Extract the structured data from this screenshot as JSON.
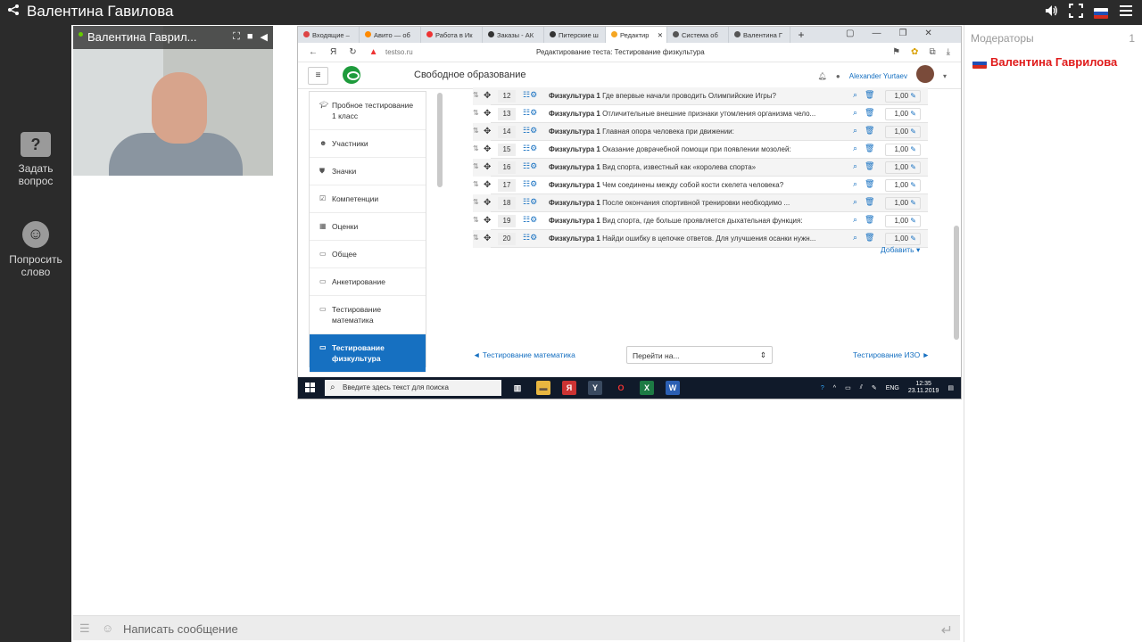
{
  "app": {
    "title": "Валентина Гавилова"
  },
  "left_actions": [
    {
      "icon": "question-icon",
      "label": "Задать вопрос"
    },
    {
      "icon": "hand-raise-icon",
      "label": "Попросить слово"
    }
  ],
  "video": {
    "name": "Валентина Гаврил..."
  },
  "browser": {
    "tabs": [
      {
        "label": "Входящие –",
        "color": "#d44"
      },
      {
        "label": "Авито — об",
        "color": "#ff8a00"
      },
      {
        "label": "Работа в Ик",
        "color": "#e33"
      },
      {
        "label": "Заказы - АК",
        "color": "#333"
      },
      {
        "label": "Питерские ш",
        "color": "#333"
      },
      {
        "label": "Редактир",
        "color": "#f5a623",
        "active": true
      },
      {
        "label": "Система об",
        "color": "#555"
      },
      {
        "label": "Валентина Г",
        "color": "#555"
      }
    ],
    "url": "testso.ru",
    "page_title": "Редактирование теста: Тестирование физкультура",
    "site_name": "Свободное образование",
    "user_name": "Alexander Yurtaev"
  },
  "sidebar": {
    "items": [
      {
        "icon": "graduation-icon",
        "label": "Пробное тестирование 1 класс"
      },
      {
        "icon": "users-icon",
        "label": "Участники"
      },
      {
        "icon": "shield-icon",
        "label": "Значки"
      },
      {
        "icon": "checkbox-icon",
        "label": "Компетенции"
      },
      {
        "icon": "table-icon",
        "label": "Оценки"
      },
      {
        "icon": "folder-icon",
        "label": "Общее"
      },
      {
        "icon": "folder-icon",
        "label": "Анкетирование"
      },
      {
        "icon": "folder-icon",
        "label": "Тестирование математика"
      },
      {
        "icon": "folder-icon",
        "label": "Тестирование физкультура",
        "active": true
      },
      {
        "icon": "folder-icon",
        "label": "Тестирование ИЗО"
      }
    ]
  },
  "questions": [
    {
      "num": "12",
      "cat": "Физкультура 1",
      "text": "Где впервые начали проводить Олимпийские Игры?",
      "mark": "1,00"
    },
    {
      "num": "13",
      "cat": "Физкультура 1",
      "text": "Отличительные внешние признаки утомления организма чело...",
      "mark": "1,00"
    },
    {
      "num": "14",
      "cat": "Физкультура 1",
      "text": "Главная опора человека при движении:",
      "mark": "1,00"
    },
    {
      "num": "15",
      "cat": "Физкультура 1",
      "text": "Оказание доврачебной помощи при появлении мозолей:",
      "mark": "1,00"
    },
    {
      "num": "16",
      "cat": "Физкультура 1",
      "text": "Вид спорта, известный как «королева спорта»",
      "mark": "1,00"
    },
    {
      "num": "17",
      "cat": "Физкультура 1",
      "text": "Чем соединены между собой кости скелета человека?",
      "mark": "1,00"
    },
    {
      "num": "18",
      "cat": "Физкультура 1",
      "text": "После окончания спортивной тренировки необходимо ...",
      "mark": "1,00"
    },
    {
      "num": "19",
      "cat": "Физкультура 1",
      "text": "Вид спорта, где больше проявляется дыхательная функция:",
      "mark": "1,00"
    },
    {
      "num": "20",
      "cat": "Физкультура 1",
      "text": "Найди ошибку в цепочке ответов. Для улучшения осанки нужн...",
      "mark": "1,00"
    }
  ],
  "add_label": "Добавить",
  "pagenav": {
    "prev": "◄ Тестирование математика",
    "jump": "Перейти на...",
    "next": "Тестирование ИЗО ►"
  },
  "taskbar": {
    "search_placeholder": "Введите здесь текст для поиска",
    "lang": "ENG",
    "time": "12:35",
    "date": "23.11.2019"
  },
  "moderators": {
    "title": "Модераторы",
    "count": "1",
    "users": [
      {
        "name": "Валентина Гаврилова"
      }
    ]
  },
  "chat": {
    "placeholder": "Написать сообщение"
  }
}
